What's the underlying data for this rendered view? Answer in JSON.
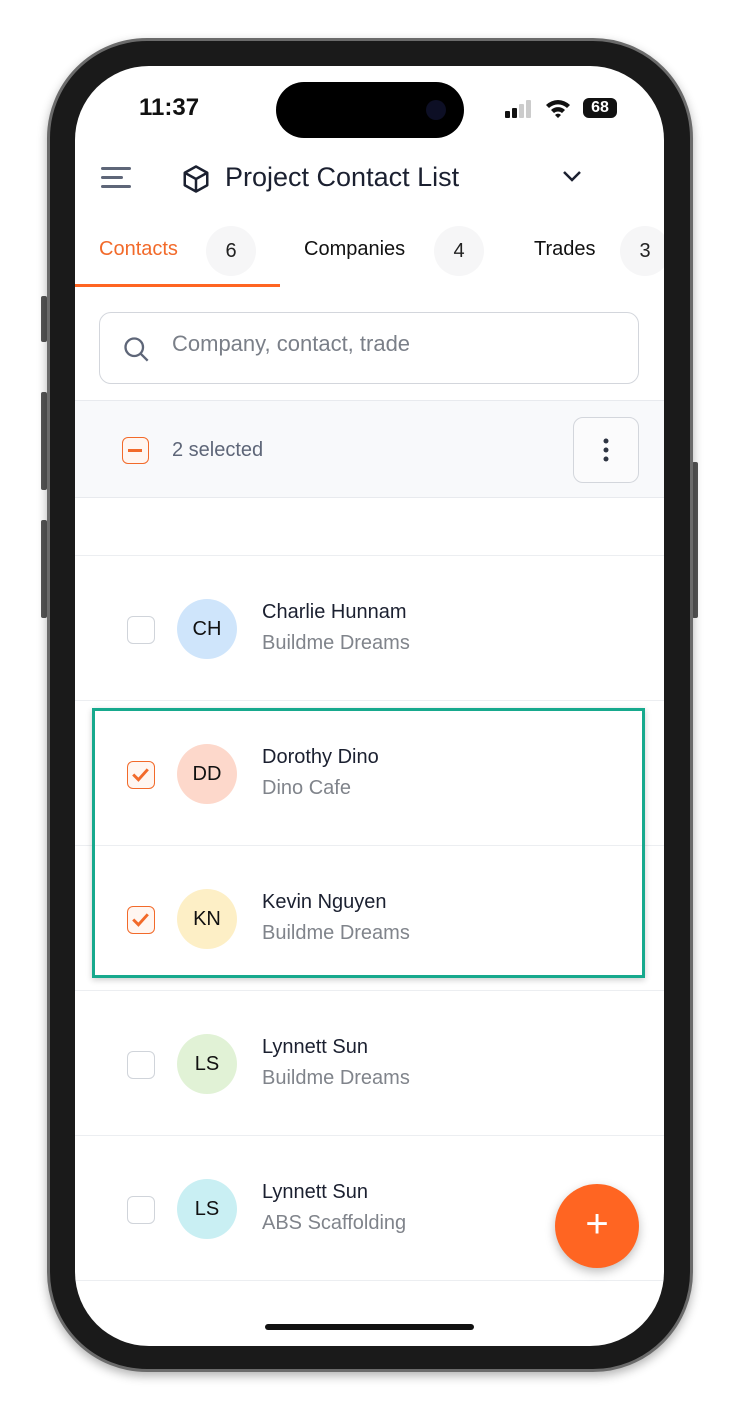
{
  "status": {
    "time": "11:37",
    "battery": "68"
  },
  "header": {
    "title": "Project Contact List"
  },
  "tabs": [
    {
      "label": "Contacts",
      "count": "6",
      "active": true
    },
    {
      "label": "Companies",
      "count": "4"
    },
    {
      "label": "Trades",
      "count": "3"
    }
  ],
  "search": {
    "placeholder": "Company, contact, trade",
    "value": ""
  },
  "selection": {
    "label": "2 selected"
  },
  "contacts": [
    {
      "initials": "CH",
      "name": "Charlie Hunnam",
      "company": "Buildme Dreams",
      "checked": false,
      "color": "#cfe5fb"
    },
    {
      "initials": "DD",
      "name": "Dorothy Dino",
      "company": "Dino Cafe",
      "checked": true,
      "color": "#fdd8cb"
    },
    {
      "initials": "KN",
      "name": "Kevin Nguyen",
      "company": "Buildme Dreams",
      "checked": true,
      "color": "#fdefc6"
    },
    {
      "initials": "LS",
      "name": "Lynnett Sun",
      "company": "Buildme Dreams",
      "checked": false,
      "color": "#e1f2d6"
    },
    {
      "initials": "LS",
      "name": "Lynnett Sun",
      "company": "ABS Scaffolding",
      "checked": false,
      "color": "#c9eff3"
    }
  ],
  "colors": {
    "accent": "#ff6522",
    "highlight": "#17a98d"
  },
  "fab": {
    "label": "+"
  }
}
